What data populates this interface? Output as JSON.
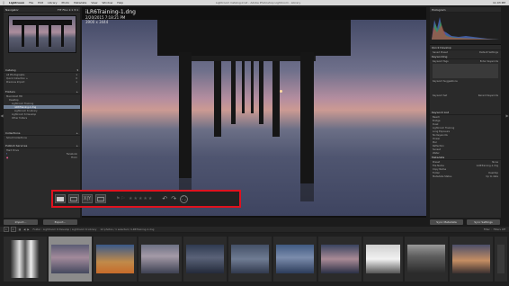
{
  "menubar": {
    "app": "Lightroom",
    "items": [
      "File",
      "Edit",
      "Library",
      "Photo",
      "Metadata",
      "View",
      "Window",
      "Help"
    ],
    "window_title": "Lightroom Catalog.lrcat - Adobe Photoshop Lightroom - Library",
    "clock": "11:03 PM"
  },
  "left_panel": {
    "navigator": {
      "title": "Navigator",
      "zoom": [
        "FIT",
        "FILL",
        "1:1",
        "3:1"
      ]
    },
    "catalog": {
      "title": "Catalog",
      "items": [
        {
          "label": "All Photographs",
          "count": "1"
        },
        {
          "label": "Quick Collection +",
          "count": "0"
        },
        {
          "label": "Previous Import",
          "count": "1"
        }
      ]
    },
    "folders": {
      "title": "Folders",
      "items": [
        {
          "label": "Macintosh HD",
          "count": ""
        },
        {
          "label": "Desktop",
          "count": ""
        },
        {
          "label": "Lightroom Training",
          "count": ""
        },
        {
          "label": "iLR6Training-1.dng",
          "count": ""
        },
        {
          "label": "Lightroom 6 Library",
          "count": ""
        },
        {
          "label": "Lightroom 6 Develop",
          "count": ""
        },
        {
          "label": "Other folders",
          "count": ""
        }
      ]
    },
    "collections": {
      "title": "Collections",
      "items": [
        {
          "label": "Smart Collections"
        }
      ]
    },
    "publish": {
      "title": "Publish Services",
      "items": [
        {
          "label": "Hard Drive"
        },
        {
          "label": "Facebook"
        },
        {
          "label": "Flickr"
        }
      ]
    },
    "import_label": "Import...",
    "export_label": "Export..."
  },
  "right_panel": {
    "histogram": {
      "title": "Histogram"
    },
    "quick_develop": {
      "title": "Quick Develop",
      "preset_label": "Saved Preset",
      "preset_value": "Default Settings"
    },
    "keywording": {
      "title": "Keywording"
    },
    "keyword_tags": {
      "label": "Keyword Tags",
      "value": "Enter Keywords"
    },
    "keyword_suggestions": {
      "label": "Keyword Suggestions"
    },
    "keyword_set": {
      "label": "Keyword Set",
      "value": "Recent Keywords"
    },
    "keyword_list": {
      "title": "Keyword List",
      "items": [
        "Beach",
        "Bridge",
        "Dusk",
        "Lightroom Training",
        "Long Exposure",
        "No Keywords",
        "Ocean",
        "Pier",
        "Reflection",
        "Sunset",
        "Water"
      ]
    },
    "metadata": {
      "title": "Metadata",
      "preset_label": "Preset",
      "preset_value": "None",
      "fields": [
        {
          "label": "File Name",
          "value": "iLR6Training-1.dng"
        },
        {
          "label": "Copy Name",
          "value": ""
        },
        {
          "label": "Folder",
          "value": "Desktop"
        },
        {
          "label": "Metadata Status",
          "value": "Up to date"
        }
      ]
    },
    "sync_label": "Sync Metadata",
    "reset_label": "Sync Settings"
  },
  "image_info": {
    "filename": "iLR6Training-1.dng",
    "line2": "2/20/2015 7:18:21 PM",
    "line3": "3900 x 3444"
  },
  "toolbar": {
    "view_modes": [
      "Grid",
      "Loupe",
      "Compare",
      "Survey"
    ],
    "flags": [
      "flag-pick",
      "flag-reject"
    ],
    "stars_rating": 0,
    "stars_total": 5,
    "rotate": [
      "rotate-left",
      "rotate-right"
    ],
    "zoom_tool": "crop-zoom"
  },
  "filmstrip": {
    "bar": {
      "page_left": "1",
      "page_right": "2",
      "source_text": "Folder : Lightroom 6 Develop / Lightroom 6 Library",
      "photo_count": "12 photos / 1 selected / iLR6Training-1.dng",
      "filter_label": "Filter :",
      "filter_value": "Filters Off"
    },
    "thumbs": [
      {
        "name": "city-bw"
      },
      {
        "name": "pier-selected"
      },
      {
        "name": "city-night"
      },
      {
        "name": "pier-dusk"
      },
      {
        "name": "pier-dark"
      },
      {
        "name": "cloudy-sea"
      },
      {
        "name": "pier-blue"
      },
      {
        "name": "dusk-sky"
      },
      {
        "name": "bw-landscape"
      },
      {
        "name": "bw-pier"
      },
      {
        "name": "sunset-coast"
      }
    ]
  },
  "colors": {
    "panel": "#2a2a2a",
    "background": "#1b1b1b",
    "highlight_box": "#e0121e",
    "selected_row": "#6f7f95"
  }
}
